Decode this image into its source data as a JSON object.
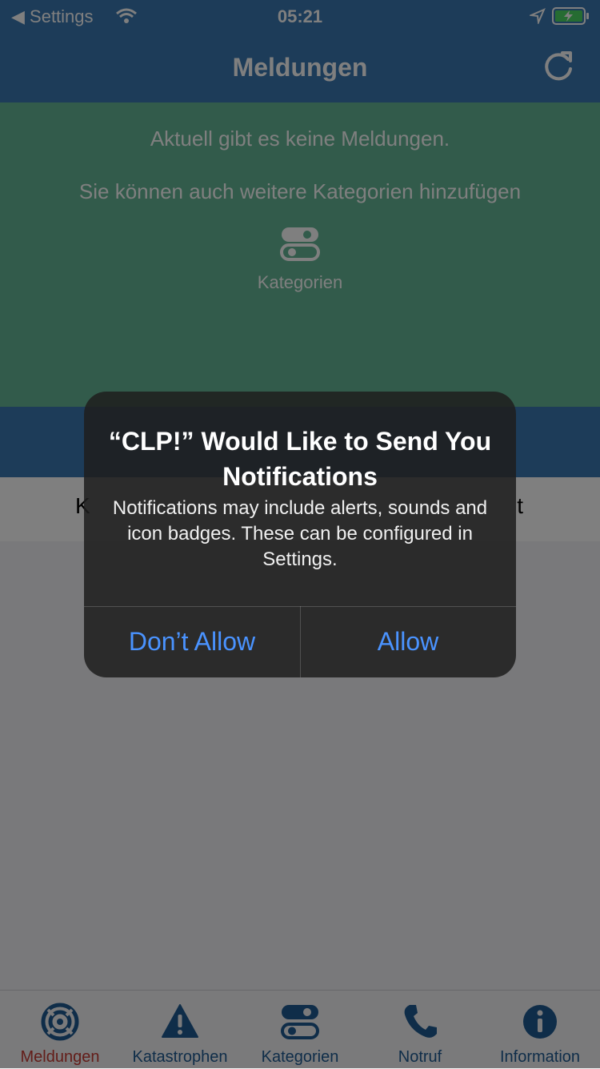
{
  "status_bar": {
    "back_label": "◀ Settings",
    "time": "05:21"
  },
  "nav": {
    "title": "Meldungen"
  },
  "empty_state": {
    "message": "Aktuell gibt es keine Meldungen.",
    "hint": "Sie können auch weitere Kategorien hinzufügen",
    "button_label": "Kategorien"
  },
  "filter": {
    "left_partial": "K",
    "right_partial": "t"
  },
  "alert": {
    "title": "“CLP!” Would Like to Send You Notifications",
    "message": "Notifications may include alerts, sounds and icon badges. These can be configured in Settings.",
    "deny_label": "Don’t Allow",
    "allow_label": "Allow"
  },
  "tabs": [
    {
      "label": "Meldungen",
      "icon": "target-icon",
      "active": true
    },
    {
      "label": "Katastrophen",
      "icon": "warning-icon",
      "active": false
    },
    {
      "label": "Kategorien",
      "icon": "toggles-icon",
      "active": false
    },
    {
      "label": "Notruf",
      "icon": "phone-icon",
      "active": false
    },
    {
      "label": "Information",
      "icon": "info-icon",
      "active": false
    }
  ],
  "colors": {
    "brand_blue": "#3b79b2",
    "green": "#65b796",
    "active_tab": "#c63a32",
    "tab_blue": "#1f5b93",
    "alert_button": "#4a93ff"
  }
}
